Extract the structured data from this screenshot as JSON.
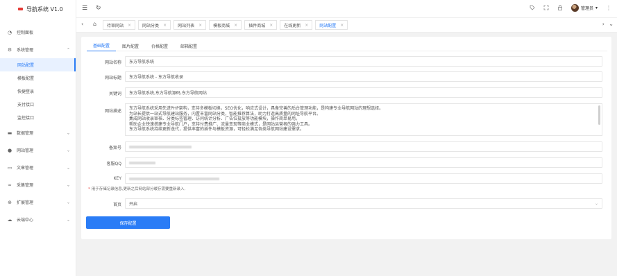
{
  "app": {
    "title": "导航系统 V1.0"
  },
  "sidebar": {
    "items": [
      {
        "label": "控制面板",
        "icon": "dashboard-icon"
      },
      {
        "label": "系统管理",
        "icon": "gear-icon",
        "expanded": true,
        "children": [
          "网站配置",
          "模板配置",
          "快捷登录",
          "支付接口",
          "监控接口"
        ]
      },
      {
        "label": "数据管理",
        "icon": "database-icon"
      },
      {
        "label": "网站管理",
        "icon": "globe-icon"
      },
      {
        "label": "文章管理",
        "icon": "folder-icon"
      },
      {
        "label": "采集管理",
        "icon": "link-icon"
      },
      {
        "label": "扩展管理",
        "icon": "plus-circle-icon"
      },
      {
        "label": "云端中心",
        "icon": "cloud-icon"
      }
    ]
  },
  "topbar": {
    "menu_icon": "☰",
    "refresh_icon": "↻",
    "user_name": "管理员",
    "user_caret": "▾",
    "more_icon": "⋮",
    "icons": [
      "tag-icon",
      "fullscreen-icon",
      "lock-icon"
    ]
  },
  "tabs": {
    "prev": "‹",
    "home": "⌂",
    "next": "›",
    "dropdown": "⌄",
    "items": [
      {
        "label": "待审网站"
      },
      {
        "label": "网站分类"
      },
      {
        "label": "网站列表"
      },
      {
        "label": "模板商城"
      },
      {
        "label": "插件商城"
      },
      {
        "label": "在线更新"
      },
      {
        "label": "网站配置",
        "active": true
      }
    ],
    "close": "×"
  },
  "inner_tabs": [
    "基础配置",
    "图片配置",
    "价格配置",
    "邮箱配置"
  ],
  "form": {
    "site_name": {
      "label": "网站名称",
      "value": "东方导航系统"
    },
    "site_title": {
      "label": "网站标题",
      "value": "东方导航系统 - 东方导航收录"
    },
    "keywords": {
      "label": "关键词",
      "value": "东方导航系统,东方导航源码,东方导航网站"
    },
    "description": {
      "label": "网站描述",
      "lines": [
        "东方导航系统采用先进PHP架构，支持多模板切换，SEO优化，响应式设计，具备完善的后台管理功能，是构建专业导航网站的理想选择。",
        "为站长提供一站式导航建站服务，内置丰富网站分类，智能推荐算法，助力打造高质量的网址导航平台。",
        "集成网站收录审核、分类标签管理、访问统计分析、广告位投放等功能模块，操作简单易用。",
        "帮助企业快速搭建专业导航门户，支持付费推广、流量变现等商业模式，是网站运营者的强力工具。",
        "东方导航系统持续更新迭代，提供丰富的插件与模板资源，可轻松满足各类导航网站建设需求。"
      ]
    },
    "icp": {
      "label": "备案号",
      "value": ""
    },
    "qq": {
      "label": "客服QQ",
      "value": ""
    },
    "key": {
      "label": "KEY",
      "value": ""
    },
    "key_note": "用于存储记录信息,更新之后网站部分缓存需要重新录入.",
    "key_note_star": "*",
    "homepage": {
      "label": "首页",
      "value": "开启",
      "arrow": "⌄"
    },
    "save_label": "保存配置"
  }
}
